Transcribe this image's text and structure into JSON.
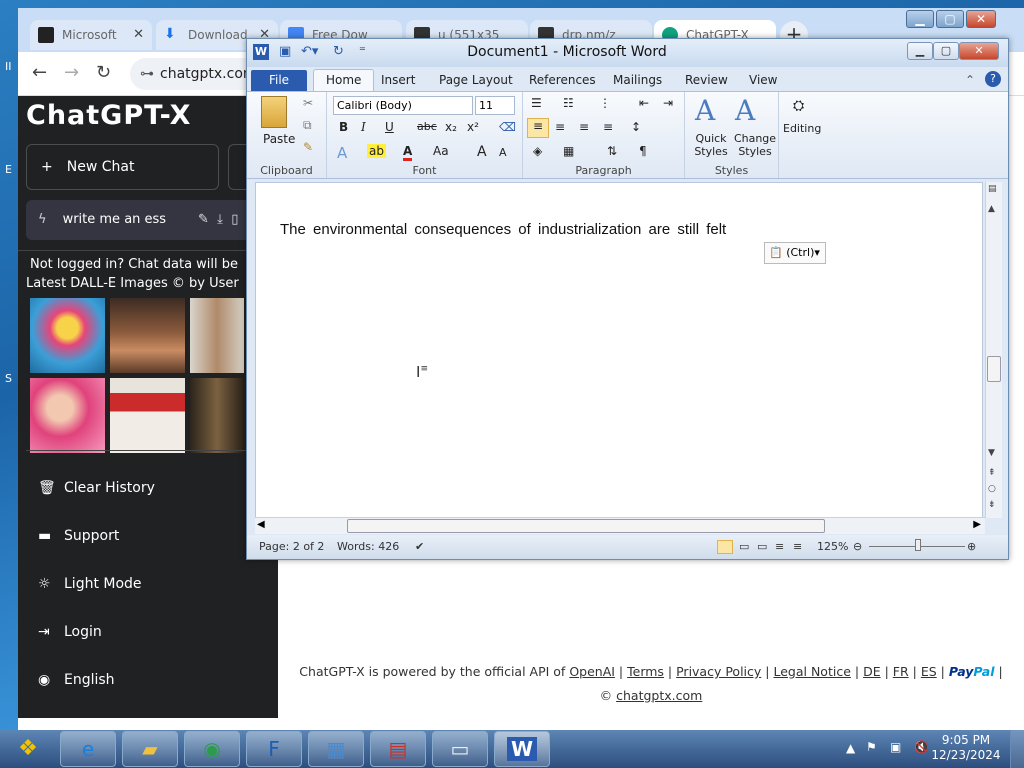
{
  "desktop": {
    "edge_letters": [
      "II",
      "E",
      "S"
    ]
  },
  "chrome": {
    "tabs": [
      {
        "label": "Microsoft",
        "icon": "museum-icon",
        "color": "#222"
      },
      {
        "label": "Download",
        "icon": "download-icon",
        "color": "#1a73e8"
      },
      {
        "label": "Free Dow",
        "icon": "file-icon",
        "color": "#4285f4"
      },
      {
        "label": "u (551x35",
        "icon": "terminal-icon",
        "color": "#333"
      },
      {
        "label": "drp.nm/z",
        "icon": "terminal-icon",
        "color": "#333"
      },
      {
        "label": "ChatGPT-X",
        "icon": "chatgpt-icon",
        "color": "#10a37f"
      }
    ],
    "url": "chatgptx.com"
  },
  "chatgpt": {
    "logo": "ChatGPT-X",
    "new_chat": "New Chat",
    "history_item": "write me an ess",
    "notice": "Not logged in? Chat data will be",
    "dalle_title": "Latest DALL-E Images © by User",
    "menu": [
      {
        "label": "Clear History",
        "icon": "trash-icon",
        "glyph": "🗑"
      },
      {
        "label": "Support",
        "icon": "support-icon",
        "glyph": "▬"
      },
      {
        "label": "Light Mode",
        "icon": "sun-icon",
        "glyph": "☼"
      },
      {
        "label": "Login",
        "icon": "login-icon",
        "glyph": "⇥"
      },
      {
        "label": "English",
        "icon": "globe-icon",
        "glyph": "◉"
      }
    ],
    "footer": {
      "powered": "ChatGPT-X is powered by the official API of",
      "openai": "OpenAI",
      "terms": "Terms",
      "privacy": "Privacy Policy",
      "legal": "Legal Notice",
      "de": "DE",
      "fr": "FR",
      "es": "ES",
      "paypal_a": "Pay",
      "paypal_b": "Pal",
      "copyright": "©",
      "site": "chatgptx.com"
    }
  },
  "word": {
    "title": "Document1  -  Microsoft Word",
    "tabs": {
      "file": "File",
      "home": "Home",
      "insert": "Insert",
      "layout": "Page Layout",
      "references": "References",
      "mailings": "Mailings",
      "review": "Review",
      "view": "View"
    },
    "ribbon": {
      "paste": "Paste",
      "clipboard": "Clipboard",
      "font_name": "Calibri (Body)",
      "font_size": "11",
      "font": "Font",
      "bold": "B",
      "italic": "I",
      "underline": "U",
      "strike": "abc",
      "sub": "x₂",
      "sup": "x²",
      "paragraph": "Paragraph",
      "quick_styles": "Quick Styles",
      "change_styles": "Change Styles",
      "styles": "Styles",
      "editing": "Editing"
    },
    "document_text": "The environmental consequences of industrialization are still felt",
    "paste_options": "(Ctrl)",
    "status": {
      "page": "Page: 2 of 2",
      "words": "Words: 426",
      "zoom": "125%"
    }
  },
  "taskbar": {
    "time": "9:05 PM",
    "date": "12/23/2024"
  }
}
